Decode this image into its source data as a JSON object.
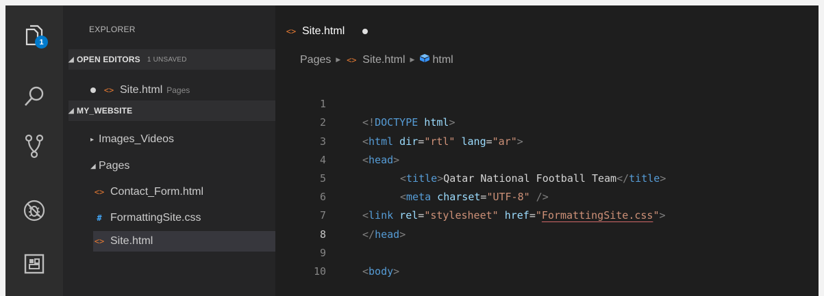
{
  "activity_bar": {
    "explorer_badge": "1"
  },
  "sidebar": {
    "title": "EXPLORER",
    "open_editors": {
      "label": "OPEN EDITORS",
      "unsaved": "1 UNSAVED",
      "items": [
        {
          "name": "Site.html",
          "hint": "Pages"
        }
      ]
    },
    "project": {
      "label": "MY_WEBSITE",
      "folders": [
        {
          "name": "Images_Videos",
          "expanded": false
        },
        {
          "name": "Pages",
          "expanded": true
        }
      ],
      "files": [
        {
          "name": "Contact_Form.html",
          "type": "html"
        },
        {
          "name": "FormattingSite.css",
          "type": "css"
        },
        {
          "name": "Site.html",
          "type": "html"
        }
      ]
    }
  },
  "editor": {
    "tab_label": "Site.html",
    "breadcrumb": [
      "Pages",
      "Site.html",
      "html"
    ],
    "line_numbers": [
      "1",
      "2",
      "3",
      "4",
      "5",
      "6",
      "7",
      "8",
      "9",
      "10"
    ],
    "code": {
      "l1": {
        "a": "<!",
        "b": "DOCTYPE",
        "c": " html",
        "d": ">"
      },
      "l2": {
        "a": "<",
        "b": "html",
        "c": " dir",
        "d": "=",
        "e": "\"rtl\"",
        "f": " lang",
        "g": "=",
        "h": "\"ar\"",
        "i": ">"
      },
      "l3": {
        "a": "<",
        "b": "head",
        "c": ">"
      },
      "l4": {
        "a": "<",
        "b": "title",
        "c": ">",
        "d": "Qatar National Football Team",
        "e": "</",
        "f": "title",
        "g": ">"
      },
      "l5": {
        "a": "<",
        "b": "meta",
        "c": " charset",
        "d": "=",
        "e": "\"UTF-8\"",
        "f": " />"
      },
      "l6": {
        "a": "<",
        "b": "link",
        "c": " rel",
        "d": "=",
        "e": "\"stylesheet\"",
        "f": " href",
        "g": "=",
        "h": "\"",
        "i": "FormattingSite.css",
        "j": "\"",
        "k": ">"
      },
      "l7": {
        "a": "</",
        "b": "head",
        "c": ">"
      },
      "l9": {
        "a": "<",
        "b": "body",
        "c": ">"
      }
    }
  }
}
